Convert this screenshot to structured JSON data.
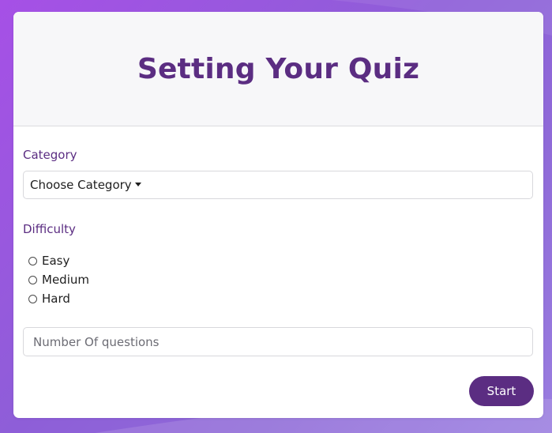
{
  "header": {
    "title": "Setting Your Quiz"
  },
  "category": {
    "label": "Category",
    "selected": "Choose Category"
  },
  "difficulty": {
    "label": "Difficulty",
    "options": [
      {
        "label": "Easy",
        "checked": false
      },
      {
        "label": "Medium",
        "checked": false
      },
      {
        "label": "Hard",
        "checked": false
      }
    ]
  },
  "questions": {
    "placeholder": "Number Of questions",
    "value": ""
  },
  "actions": {
    "start_label": "Start"
  },
  "colors": {
    "accent": "#5b2d82",
    "background_start": "#a650e6",
    "background_end": "#9a7ee0"
  }
}
